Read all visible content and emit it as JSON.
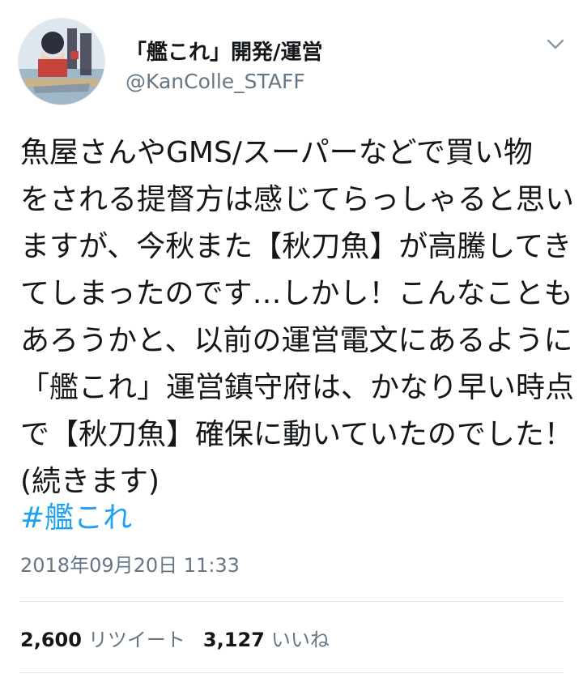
{
  "tweet": {
    "display_name": "「艦これ」開発/運営",
    "handle": "@KanColle_STAFF",
    "body_lines": [
      "魚屋さんやGMS/スーパーなどで買い物",
      "をされる提督方は感じてらっしゃると思い",
      "ますが、今秋また【秋刀魚】が高騰してき",
      "てしまったのです…しかし！こんなことも",
      "あろうかと、以前の運営電文にあるように",
      "「艦これ」運営鎮守府は、かなり早い時点",
      "で【秋刀魚】確保に動いていたのでした！",
      "(続きます)"
    ],
    "hashtag": "#艦これ",
    "timestamp": "2018年09月20日 11:33",
    "retweets": {
      "count": "2,600",
      "label": "リツイート"
    },
    "likes": {
      "count": "3,127",
      "label": "いいね"
    }
  },
  "icons": {
    "avatar": "avatar-image",
    "caret": "chevron-down-icon"
  },
  "colors": {
    "link": "#1da1f2",
    "secondary_text": "#657786",
    "divider": "#e1e8ed"
  }
}
